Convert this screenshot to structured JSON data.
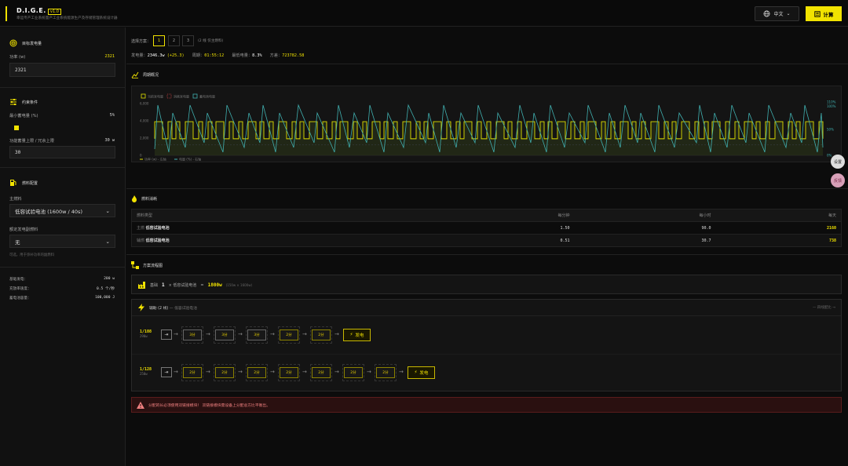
{
  "app": {
    "title": "D.I.G.E.",
    "version": "v1.0",
    "subtitle": "幸运专产工业系统量产工业系统能源生产及存储管理系统设计器",
    "lang": "中文",
    "calc": "计算"
  },
  "sidebar": {
    "target": {
      "title": "目标发电量",
      "power_label": "功率 (w)",
      "power_value": "2321",
      "power_input": "2321"
    },
    "constraints": {
      "title": "约束条件",
      "min_label": "最小蓄电量 (%)",
      "min_value": "5%",
      "cap_label": "功能蓄量上限 / 冗余上限",
      "cap_value": "30 w",
      "cap_input": "30"
    },
    "fuel": {
      "title": "燃料配置",
      "main_label": "主燃料",
      "main_value": "低容试验电池 (1600w / 40s)",
      "aux_label": "额定发电副燃料",
      "aux_value": "无",
      "hint": "可选，用于弥补功率的副燃料"
    },
    "stats": [
      {
        "label": "基础发电：",
        "value": "200 w"
      },
      {
        "label": "充放率速度：",
        "value": "0.5 个/秒"
      },
      {
        "label": "蓄电池容量：",
        "value": "100,000 J"
      }
    ]
  },
  "scheme": {
    "label": "选择方案：",
    "options": [
      "1",
      "2",
      "3"
    ],
    "note": "(2 线 仅主燃料)",
    "power_label": "发电量：",
    "power_val": "2346.3w",
    "power_diff": "(+25.3)",
    "period_label": "周期：",
    "period_val": "01:55:12",
    "min_label": "最低电量：",
    "min_val": "8.3%",
    "var_label": "方差：",
    "var_val": "723782.58"
  },
  "chart": {
    "title": "周期概况",
    "legend": [
      "当前发电量",
      "消耗发电量",
      "蓄电池电量"
    ],
    "bottom_legend": [
      "功率 (w) - 左轴",
      "电量 (%) - 右轴"
    ],
    "left_ticks": [
      "6,000",
      "4,000",
      "2,000",
      "0"
    ],
    "right_ticks": [
      "110%",
      "100%",
      "50%",
      "0%"
    ],
    "colors": {
      "power": "#e0e000",
      "battery": "#40b0b0",
      "fill": "#2a3318"
    }
  },
  "chart_data": {
    "type": "line",
    "series": [
      {
        "name": "功率 (w) - 左轴",
        "axis": "left",
        "pattern": "step pulses between ~1800 and ~3900"
      },
      {
        "name": "电量 (%) - 右轴",
        "axis": "right",
        "pattern": "sawtooth between ~10% and ~100%"
      }
    ],
    "ylim_left": [
      0,
      6000
    ],
    "ylim_right": [
      0,
      110
    ]
  },
  "fuel_table": {
    "title": "燃料消耗",
    "headers": [
      "燃料类型",
      "每分钟",
      "每小时",
      "每天"
    ],
    "rows": [
      {
        "tag": "主燃",
        "name": "低容试验电池",
        "per_min": "1.50",
        "per_hour": "90.0",
        "per_day": "2160"
      },
      {
        "tag": "辅燃",
        "name": "低容试验电池",
        "per_min": "0.51",
        "per_hour": "30.7",
        "per_day": "738"
      }
    ]
  },
  "plan": {
    "title": "方案流程图",
    "base": {
      "label": "基础",
      "count": "1",
      "name": "× 低容试验电池",
      "arrow": "=",
      "power": "1800w",
      "note": "(150w × 1600w)"
    },
    "aux": {
      "title": "辅助 (2 线)",
      "subtitle": "— 低容试验电池",
      "right": "— 四线配比 →",
      "lines": [
        {
          "ratio": "1/108",
          "sub": "290w",
          "nodes": [
            "3分",
            "3分",
            "3分",
            "2分",
            "2分"
          ],
          "gen": "发电"
        },
        {
          "ratio": "1/128",
          "sub": "250w",
          "nodes": [
            "2分",
            "2分",
            "2分",
            "2分",
            "2分",
            "2分",
            "2分"
          ],
          "gen": "发电"
        }
      ]
    }
  },
  "warning": "分配的长必须使用双链接模块！ 双链接模块需设备上分配总方比平衡出。",
  "fabs": [
    "设置",
    "反馈"
  ]
}
